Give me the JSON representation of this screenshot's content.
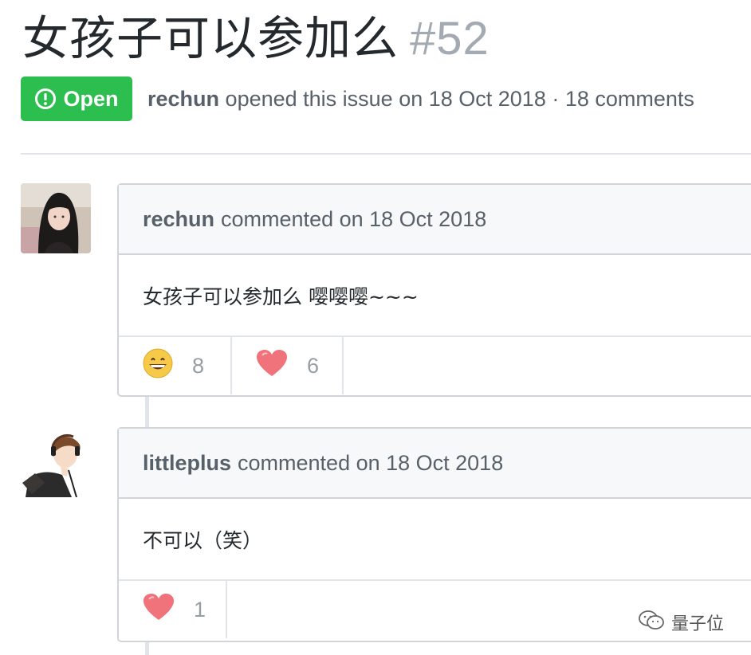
{
  "issue": {
    "title": "女孩子可以参加么",
    "number": "#52",
    "state": "Open",
    "author": "rechun",
    "meta_text": "opened this issue on 18 Oct 2018 · 18 comments"
  },
  "comments": [
    {
      "author": "rechun",
      "date_text": "commented on 18 Oct 2018",
      "body": "女孩子可以参加么 嘤嘤嘤~~~",
      "reactions": [
        {
          "icon": "grinning-face-emoji",
          "count": "8"
        },
        {
          "icon": "heart-emoji",
          "count": "6"
        }
      ]
    },
    {
      "author": "littleplus",
      "date_text": "commented on 18 Oct 2018",
      "body": "不可以（笑）",
      "reactions": [
        {
          "icon": "heart-emoji",
          "count": "1"
        }
      ]
    }
  ],
  "watermark": "量子位",
  "colors": {
    "open_green": "#2cbe4e",
    "muted_text": "#586069",
    "border": "#d1d5da",
    "header_bg": "#f6f8fa"
  }
}
